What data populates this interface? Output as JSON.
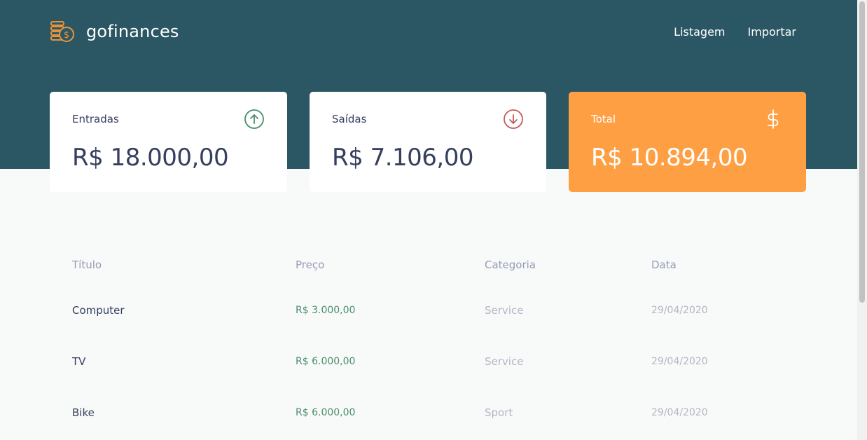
{
  "brand": {
    "name": "gofinances",
    "logo_icon": "coins-dollar-icon"
  },
  "nav": {
    "listagem": "Listagem",
    "importar": "Importar"
  },
  "cards": {
    "income": {
      "label": "Entradas",
      "value": "R$ 18.000,00",
      "icon": "arrow-up-circle-icon"
    },
    "outcome": {
      "label": "Saídas",
      "value": "R$ 7.106,00",
      "icon": "arrow-down-circle-icon"
    },
    "total": {
      "label": "Total",
      "value": "R$ 10.894,00",
      "icon": "dollar-sign-icon"
    }
  },
  "table": {
    "headers": [
      "Título",
      "Preço",
      "Categoria",
      "Data"
    ],
    "rows": [
      [
        "Computer",
        "R$ 3.000,00",
        "Service",
        "29/04/2020"
      ],
      [
        "TV",
        "R$ 6.000,00",
        "Service",
        "29/04/2020"
      ],
      [
        "Bike",
        "R$ 6.000,00",
        "Sport",
        "29/04/2020"
      ]
    ]
  },
  "colors": {
    "header": "#2b5764",
    "total_card": "#ff9f43",
    "income_accent": "#4a8e6c",
    "outcome_accent": "#c55a5a"
  }
}
